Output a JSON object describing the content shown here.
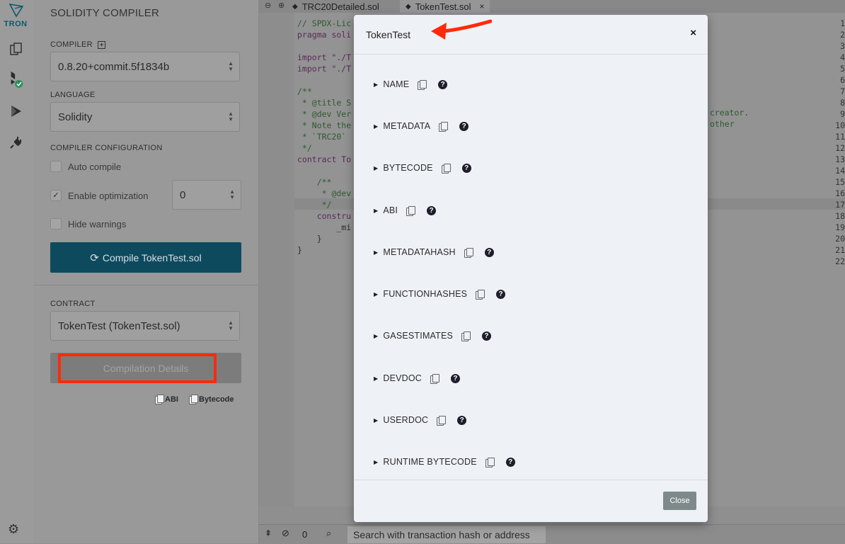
{
  "sidebar": {
    "logo_text": "TRON",
    "icons": [
      "file-explorer-icon",
      "solidity-compiler-icon",
      "deploy-run-icon",
      "plugin-manager-icon"
    ],
    "settings_icon": "gear-icon"
  },
  "compiler_panel": {
    "title": "SOLIDITY COMPILER",
    "compiler_label": "COMPILER",
    "compiler_value": "0.8.20+commit.5f1834b",
    "language_label": "LANGUAGE",
    "language_value": "Solidity",
    "config_label": "COMPILER CONFIGURATION",
    "auto_compile_label": "Auto compile",
    "optimization_label": "Enable optimization",
    "optimization_runs": "0",
    "hide_warnings_label": "Hide warnings",
    "compile_button": "Compile TokenTest.sol",
    "contract_label": "CONTRACT",
    "contract_value": "TokenTest (TokenTest.sol)",
    "details_button": "Compilation Details",
    "abi_link": "ABI",
    "bytecode_link": "Bytecode"
  },
  "tabs": [
    {
      "label": "TRC20Detailed.sol"
    },
    {
      "label": "TokenTest.sol"
    }
  ],
  "editor": {
    "line_numbers": [
      "1",
      "2",
      "3",
      "4",
      "5",
      "6",
      "7",
      "8",
      "9",
      "10",
      "11",
      "12",
      "13",
      "14",
      "15",
      "16",
      "17",
      "18",
      "19",
      "20",
      "21",
      "22"
    ],
    "lines": [
      "// SPDX-Lic",
      "pragma soli",
      "",
      "import \"./T",
      "import \"./T",
      "",
      "/**",
      " * @title S",
      " * @dev Ver",
      " * Note the",
      " * `TRC20`",
      " */",
      "contract To",
      "",
      "    /**",
      "     * @dev",
      "     */",
      "    constru",
      "        _mi",
      "    }",
      "}",
      ""
    ],
    "overflow_text_1": "e creator.",
    "overflow_text_2": "other"
  },
  "terminal": {
    "count": "0",
    "search_placeholder": "Search with transaction hash or address"
  },
  "modal": {
    "title": "TokenTest",
    "close_x": "×",
    "items": [
      "NAME",
      "METADATA",
      "BYTECODE",
      "ABI",
      "METADATAHASH",
      "FUNCTIONHASHES",
      "GASESTIMATES",
      "DEVDOC",
      "USERDOC",
      "RUNTIME BYTECODE"
    ],
    "close_button": "Close",
    "accent_color": "#ff2a0a"
  }
}
